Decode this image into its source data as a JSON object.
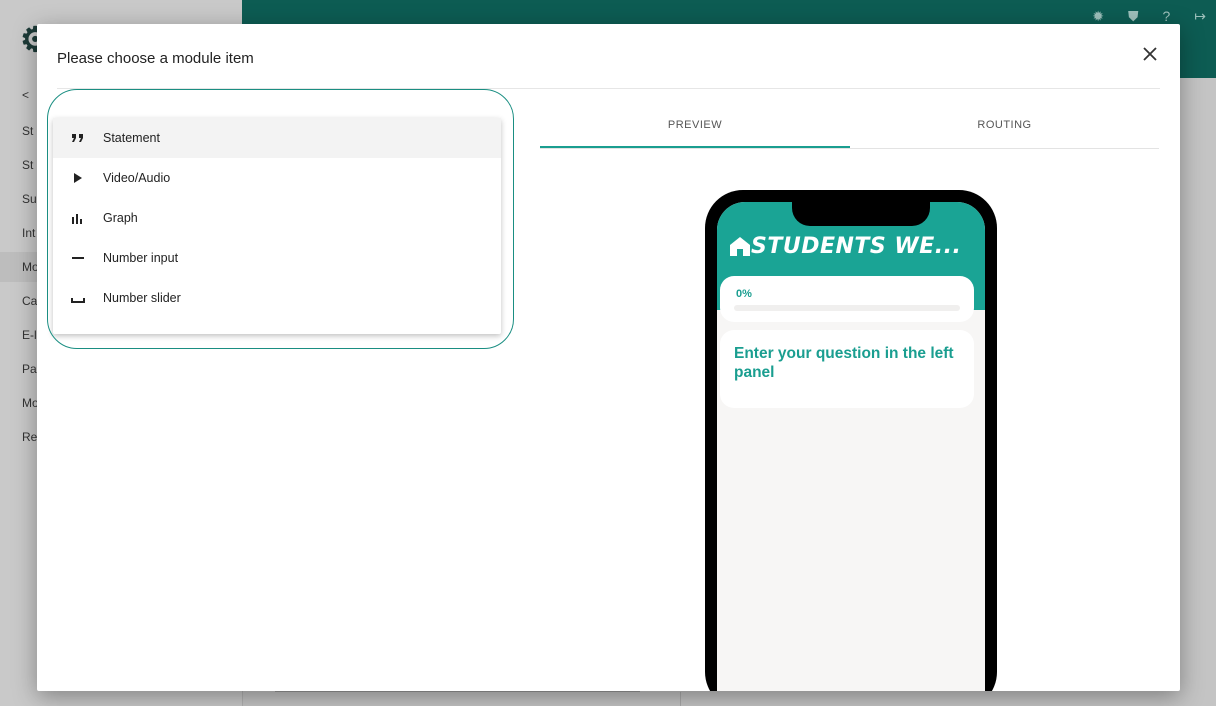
{
  "background": {
    "nav_items": [
      "<",
      "St",
      "St",
      "Su",
      "Int",
      "Mo",
      "Ca",
      "E-l",
      "Pa",
      "Mo",
      "Re"
    ]
  },
  "modal": {
    "title": "Please choose a module item",
    "close_icon": "close-icon",
    "items": [
      {
        "label": "Statement",
        "icon": "quote-icon"
      },
      {
        "label": "Video/Audio",
        "icon": "play-icon"
      },
      {
        "label": "Graph",
        "icon": "bar-chart-icon"
      },
      {
        "label": "Number input",
        "icon": "minus-icon"
      },
      {
        "label": "Number slider",
        "icon": "space-bar-icon"
      }
    ],
    "tabs": {
      "preview": "PREVIEW",
      "routing": "ROUTING",
      "active": "preview"
    }
  },
  "phone": {
    "title": "STUDENTS WE...",
    "progress_text": "0%",
    "progress_value": 0,
    "question": "Enter your question in the left panel"
  },
  "colors": {
    "accent": "#1a9e90",
    "phone_header": "#1aa495",
    "topbar": "#0d5c53"
  }
}
